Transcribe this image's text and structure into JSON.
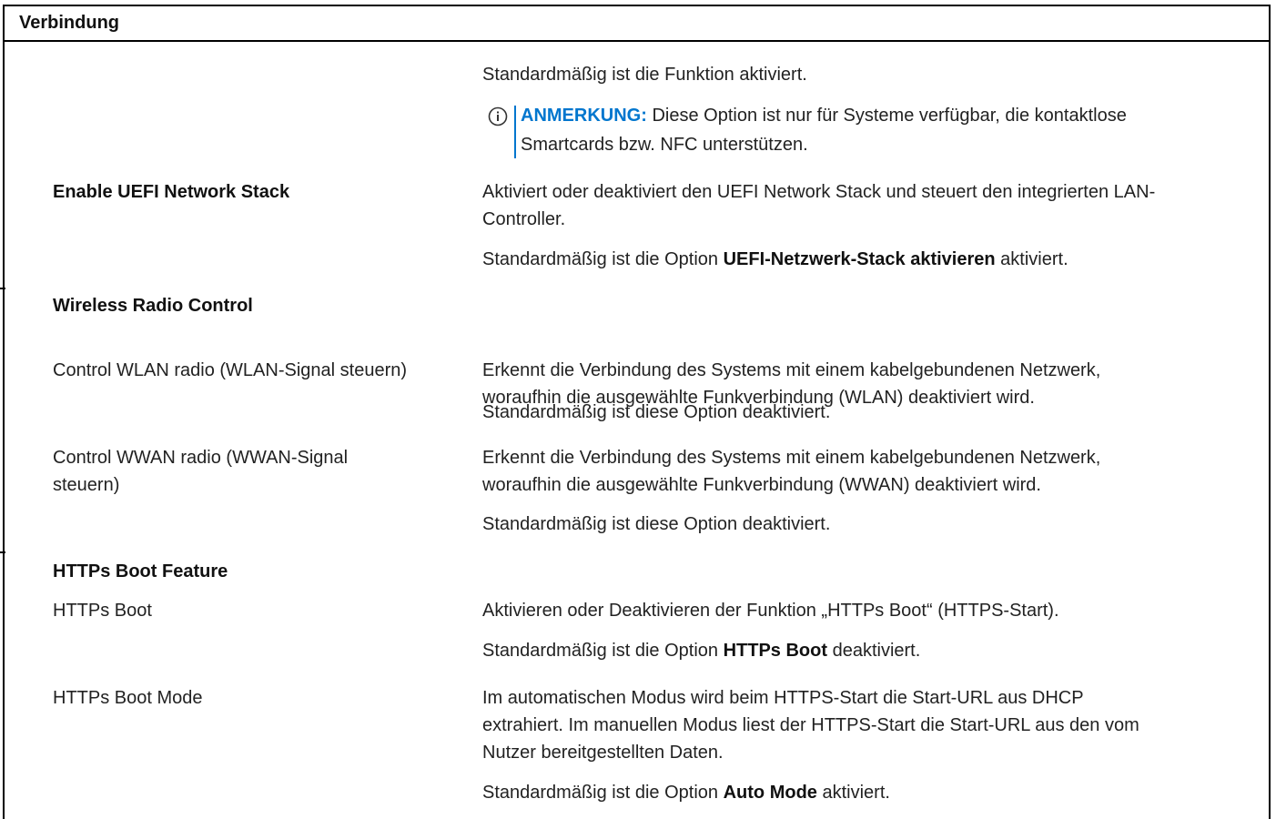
{
  "header": {
    "title": "Verbindung"
  },
  "rows": {
    "r0_desc": "Standardmäßig ist die Funktion aktiviert.",
    "note": {
      "label": "ANMERKUNG:",
      "line1": " Diese Option ist nur für Systeme verfügbar, die kontaktlose",
      "line2": "Smartcards bzw. NFC unterstützen."
    },
    "uefi": {
      "name": "Enable UEFI Network Stack",
      "desc1": "Aktiviert oder deaktiviert den UEFI Network Stack und steuert den integrierten LAN-",
      "desc2": "Controller.",
      "default_pre": "Standardmäßig ist die Option ",
      "default_bold": "UEFI-Netzwerk-Stack aktivieren",
      "default_post": " aktiviert."
    },
    "wireless_heading": "Wireless Radio Control",
    "wlan": {
      "name": "Control WLAN radio (WLAN-Signal steuern)",
      "desc1": "Erkennt die Verbindung des Systems mit einem kabelgebundenen Netzwerk,",
      "desc2": "woraufhin die ausgewählte Funkverbindung (WLAN) deaktiviert wird.",
      "default": "Standardmäßig ist diese Option deaktiviert."
    },
    "wwan": {
      "name1": "Control WWAN radio (WWAN-Signal",
      "name2": "steuern)",
      "desc1": "Erkennt die Verbindung des Systems mit einem kabelgebundenen Netzwerk,",
      "desc2": "woraufhin die ausgewählte Funkverbindung (WWAN) deaktiviert wird.",
      "default": "Standardmäßig ist diese Option deaktiviert."
    },
    "https_heading": "HTTPs Boot Feature",
    "https_boot": {
      "name": "HTTPs Boot",
      "desc": "Aktivieren oder Deaktivieren der Funktion „HTTPs Boot“ (HTTPS-Start).",
      "default_pre": "Standardmäßig ist die Option ",
      "default_bold": "HTTPs Boot",
      "default_post": " deaktiviert."
    },
    "https_mode": {
      "name": "HTTPs Boot Mode",
      "desc1": "Im automatischen Modus wird beim HTTPS-Start die Start-URL aus DHCP",
      "desc2": "extrahiert. Im manuellen Modus liest der HTTPS-Start die Start-URL aus den vom",
      "desc3": "Nutzer bereitgestellten Daten.",
      "default_pre": "Standardmäßig ist die Option ",
      "default_bold": "Auto Mode",
      "default_post": " aktiviert."
    }
  },
  "colors": {
    "note_accent": "#0076ce",
    "text": "#222222"
  },
  "icons": {
    "note": "info-icon"
  }
}
